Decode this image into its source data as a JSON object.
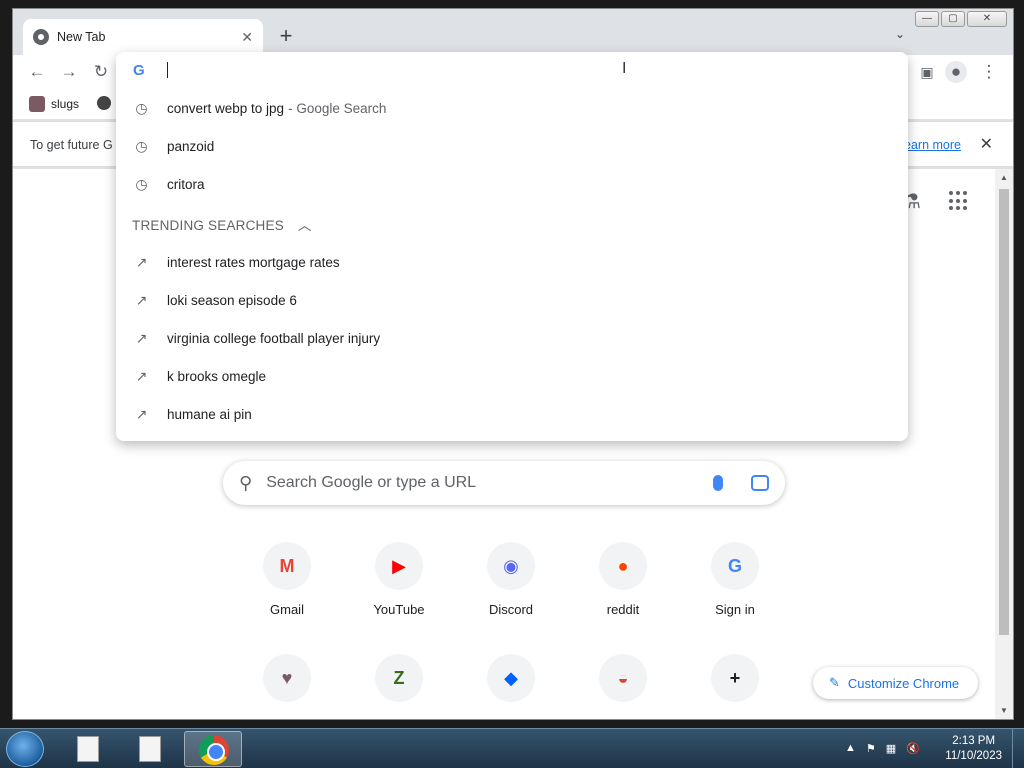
{
  "browser": {
    "tab_title": "New Tab",
    "tab_close": "✕",
    "new_tab": "+",
    "tab_search": "⌄",
    "window_buttons": {
      "minimize": "—",
      "maximize": "▢",
      "close": "✕"
    }
  },
  "toolbar": {
    "back": "←",
    "forward": "→",
    "reload": "↻"
  },
  "bookmarks": [
    {
      "label": "slugs"
    }
  ],
  "infobar": {
    "message": "To get future G",
    "learn_more": "earn more",
    "close": "✕"
  },
  "omnibox": {
    "g_logo": "G",
    "cursor_glyph": "I",
    "history": [
      {
        "text": "convert webp to jpg",
        "subtext": "- Google Search"
      },
      {
        "text": "panzoid",
        "subtext": ""
      },
      {
        "text": "critora",
        "subtext": ""
      }
    ],
    "trending_header": "TRENDING SEARCHES",
    "trending": [
      "interest rates mortgage rates",
      "loki season episode 6",
      "virginia college football player injury",
      "k brooks omegle",
      "humane ai pin"
    ]
  },
  "ntp": {
    "search_placeholder": "Search Google or type a URL",
    "shortcuts": [
      {
        "label": "Gmail",
        "glyph": "M",
        "color": "#ea4335"
      },
      {
        "label": "YouTube",
        "glyph": "▶",
        "color": "#ff0000"
      },
      {
        "label": "Discord",
        "glyph": "◉",
        "color": "#5865f2"
      },
      {
        "label": "reddit",
        "glyph": "●",
        "color": "#ff4500"
      },
      {
        "label": "Sign in",
        "glyph": "G",
        "color": "#4285f4"
      },
      {
        "label": "",
        "glyph": "♥",
        "color": "#7d5a63"
      },
      {
        "label": "",
        "glyph": "Z",
        "color": "#3a6b1f"
      },
      {
        "label": "",
        "glyph": "◆",
        "color": "#0061fe"
      },
      {
        "label": "",
        "glyph": "◒",
        "color": "#db4437"
      },
      {
        "label": "",
        "glyph": "+",
        "color": "#202124"
      }
    ],
    "customize_label": "Customize Chrome"
  },
  "taskbar": {
    "time": "2:13 PM",
    "date": "11/10/2023"
  }
}
